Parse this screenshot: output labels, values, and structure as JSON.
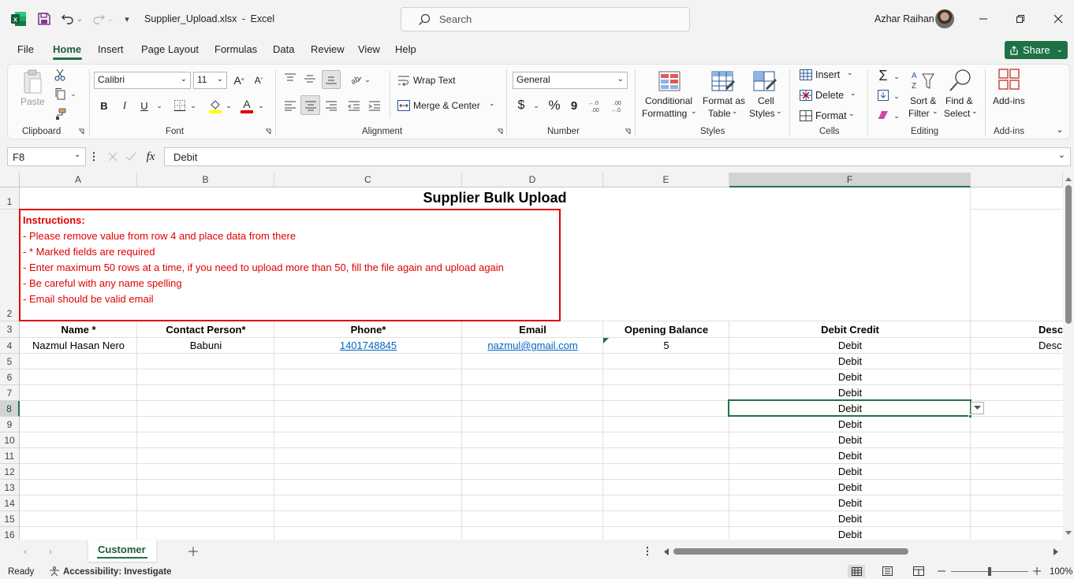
{
  "title": {
    "filename": "Supplier_Upload.xlsx",
    "separator": "-",
    "app": "Excel",
    "search_placeholder": "Search",
    "user_name": "Azhar Raihan"
  },
  "menu": [
    "File",
    "Home",
    "Insert",
    "Page Layout",
    "Formulas",
    "Data",
    "Review",
    "View",
    "Help"
  ],
  "share_label": "Share",
  "ribbon": {
    "paste": "Paste",
    "clipboard": "Clipboard",
    "font_name": "Calibri",
    "font_size": "11",
    "font": "Font",
    "wrap_text": "Wrap Text",
    "merge_center": "Merge & Center",
    "alignment": "Alignment",
    "number_format": "General",
    "number": "Number",
    "conditional_1": "Conditional",
    "conditional_2": "Formatting",
    "format_table_1": "Format as",
    "format_table_2": "Table",
    "cell_styles_1": "Cell",
    "cell_styles_2": "Styles",
    "styles": "Styles",
    "insert": "Insert",
    "delete": "Delete",
    "format": "Format",
    "cells": "Cells",
    "sort_1": "Sort &",
    "sort_2": "Filter",
    "find_1": "Find &",
    "find_2": "Select",
    "editing": "Editing",
    "addins": "Add-ins",
    "addins_group": "Add-ins",
    "bold": "B",
    "italic": "I",
    "underline": "U",
    "currency": "$",
    "percent": "%",
    "comma": "9"
  },
  "formula_bar": {
    "name_box": "F8",
    "fx": "fx",
    "content": "Debit"
  },
  "columns": [
    "A",
    "B",
    "C",
    "D",
    "E",
    "F"
  ],
  "rows": [
    "1",
    "2",
    "3",
    "4",
    "5",
    "6",
    "7",
    "8",
    "9",
    "10",
    "11",
    "12",
    "13",
    "14",
    "15",
    "16"
  ],
  "sheet": {
    "title": "Supplier Bulk Upload",
    "instructions": [
      "Instructions:",
      "- Please remove value from row 4 and place data from there",
      "- * Marked fields are required",
      "- Enter maximum 50 rows at a time, if you need to upload more than 50, fill the file again and upload again",
      "- Be careful with any name spelling",
      "- Email should be valid email"
    ],
    "headers": [
      "Name *",
      "Contact Person*",
      "Phone*",
      "Email",
      "Opening Balance",
      "Debit Credit",
      "Desc"
    ],
    "row4": [
      "Nazmul Hasan Nero",
      "Babuni",
      "1401748845",
      "nazmul@gmail.com",
      "5",
      "Debit",
      "Desc"
    ],
    "debit_credit": [
      "Debit",
      "Debit",
      "Debit",
      "Debit",
      "Debit",
      "Debit",
      "Debit",
      "Debit",
      "Debit",
      "Debit",
      "Debit",
      "Debit"
    ]
  },
  "sheet_tabs": [
    "Customer"
  ],
  "status": {
    "ready": "Ready",
    "accessibility": "Accessibility: Investigate",
    "zoom": "100%"
  },
  "colors": {
    "excel_green": "#1e7145",
    "instruction_red": "#e00000",
    "link_blue": "#0563c1",
    "selection_green": "#217346"
  }
}
